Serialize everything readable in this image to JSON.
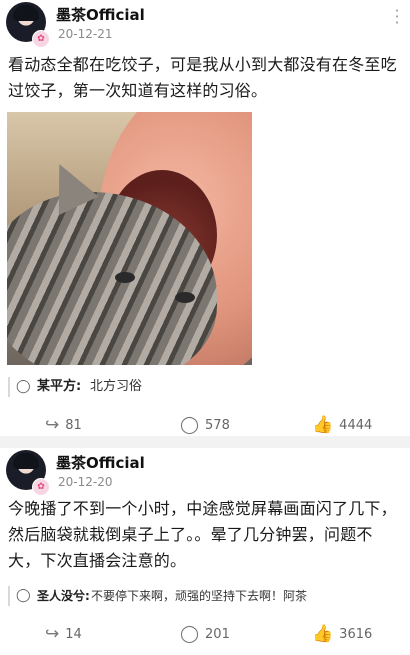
{
  "posts": [
    {
      "author": "墨茶Official",
      "date": "20-12-21",
      "text": "看动态全都在吃饺子，可是我从小到大都没有在冬至吃过饺子，第一次知道有这样的习俗。",
      "comment": {
        "user": "某平方:",
        "text": "北方习俗"
      },
      "stats": {
        "shares": "81",
        "comments": "578",
        "likes": "4444"
      }
    },
    {
      "author": "墨茶Official",
      "date": "20-12-20",
      "text": "今晚播了不到一个小时，中途感觉屏幕画面闪了几下，然后脑袋就栽倒桌子上了。。晕了几分钟罢，问题不大，下次直播会注意的。",
      "comment": {
        "user": "圣人没兮:",
        "text": "不要停下来啊，顽强的坚持下去啊！阿茶"
      },
      "stats": {
        "shares": "14",
        "comments": "201",
        "likes": "3616"
      }
    }
  ],
  "icons": {
    "menu": "more-vertical-icon",
    "comment": "comment-bubble-icon",
    "share": "share-arrow-icon",
    "like": "thumbs-up-icon",
    "badge": "verified-badge-icon"
  }
}
